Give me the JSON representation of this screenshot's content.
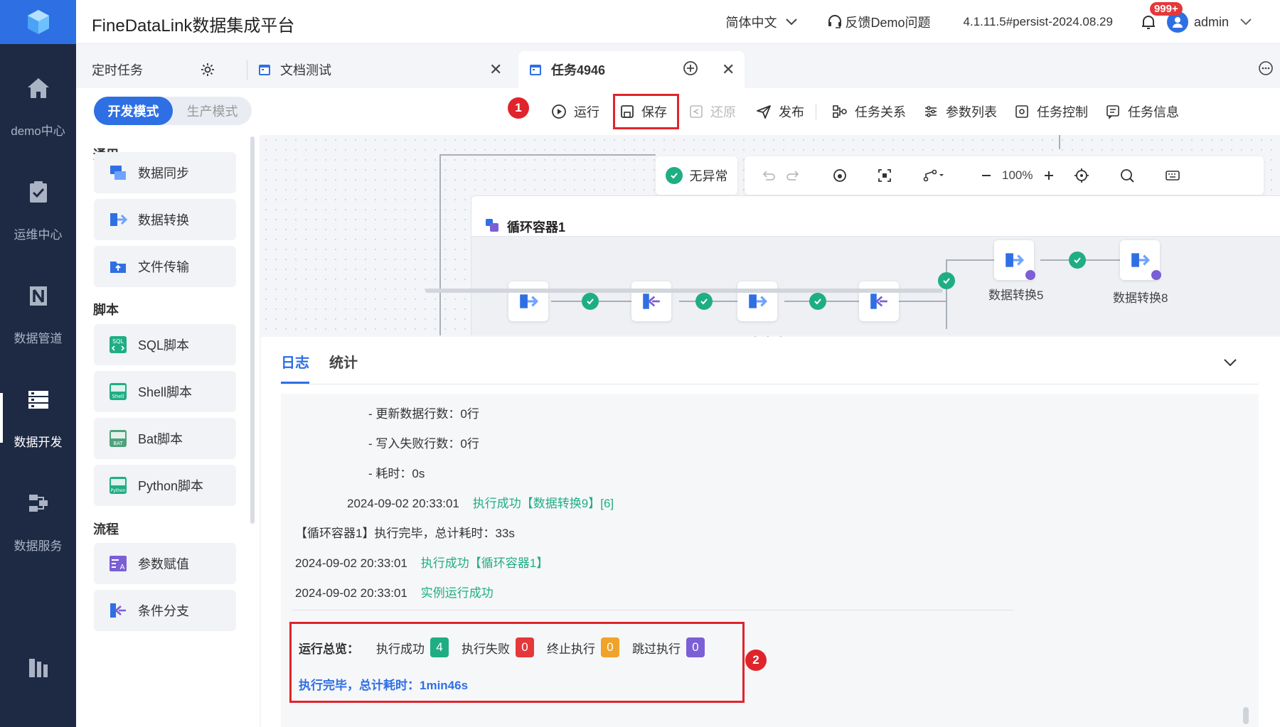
{
  "app": {
    "title": "FineDataLink数据集成平台"
  },
  "header": {
    "language": "简体中文",
    "feedback": "反馈Demo问题",
    "version": "4.1.11.5#persist-2024.08.29",
    "notifications": "999+",
    "user": "admin"
  },
  "leftnav": {
    "items": [
      {
        "label": "demo中心",
        "icon": "home-icon"
      },
      {
        "label": "运维中心",
        "icon": "clipboard-check-icon"
      },
      {
        "label": "数据管道",
        "icon": "pipeline-icon"
      },
      {
        "label": "数据开发",
        "icon": "stack-icon",
        "active": true
      },
      {
        "label": "数据服务",
        "icon": "service-icon"
      }
    ]
  },
  "tabs": {
    "items": [
      {
        "label": "定时任务"
      },
      {
        "label": "文档测试"
      },
      {
        "label": "任务4946",
        "active": true
      }
    ]
  },
  "toolbar": {
    "mode_dev": "开发模式",
    "mode_prod": "生产模式",
    "run": "运行",
    "save": "保存",
    "restore": "还原",
    "publish": "发布",
    "relations": "任务关系",
    "params": "参数列表",
    "control": "任务控制",
    "info": "任务信息",
    "marker1": "1"
  },
  "panel": {
    "sections": [
      {
        "title": "通用",
        "items": [
          "数据同步",
          "数据转换",
          "文件传输"
        ]
      },
      {
        "title": "脚本",
        "items": [
          "SQL脚本",
          "Shell脚本",
          "Bat脚本",
          "Python脚本"
        ]
      },
      {
        "title": "流程",
        "items": [
          "参数赋值",
          "条件分支"
        ]
      }
    ]
  },
  "canvas": {
    "status": "无异常",
    "zoom": "100%",
    "loop_title": "循环容器1",
    "node_label_5": "数据转换5",
    "node_label_8": "数据转换8"
  },
  "log": {
    "tab_log": "日志",
    "tab_stats": "统计",
    "lines": {
      "l1": "- 更新数据行数：0行",
      "l2": "- 写入失败行数：0行",
      "l3": "- 耗时：0s",
      "l4_time": "2024-09-02 20:33:01",
      "l4_msg": "执行成功【数据转换9】[6]",
      "l5": "【循环容器1】执行完毕，总计耗时：33s",
      "l6_time": "2024-09-02 20:33:01",
      "l6_msg": "执行成功【循环容器1】",
      "l7_time": "2024-09-02 20:33:01",
      "l7_msg": "实例运行成功"
    },
    "summary": {
      "label": "运行总览：",
      "success_label": "执行成功",
      "success_count": "4",
      "fail_label": "执行失败",
      "fail_count": "0",
      "stop_label": "终止执行",
      "stop_count": "0",
      "skip_label": "跳过执行",
      "skip_count": "0",
      "total": "执行完毕，总计耗时：1min46s",
      "marker2": "2"
    }
  },
  "colors": {
    "primary": "#2f6fe4",
    "success": "#1fae83",
    "danger": "#e5383b",
    "warning": "#f0a32a",
    "purple": "#7b5fd6",
    "nav_bg": "#1e2a44"
  }
}
